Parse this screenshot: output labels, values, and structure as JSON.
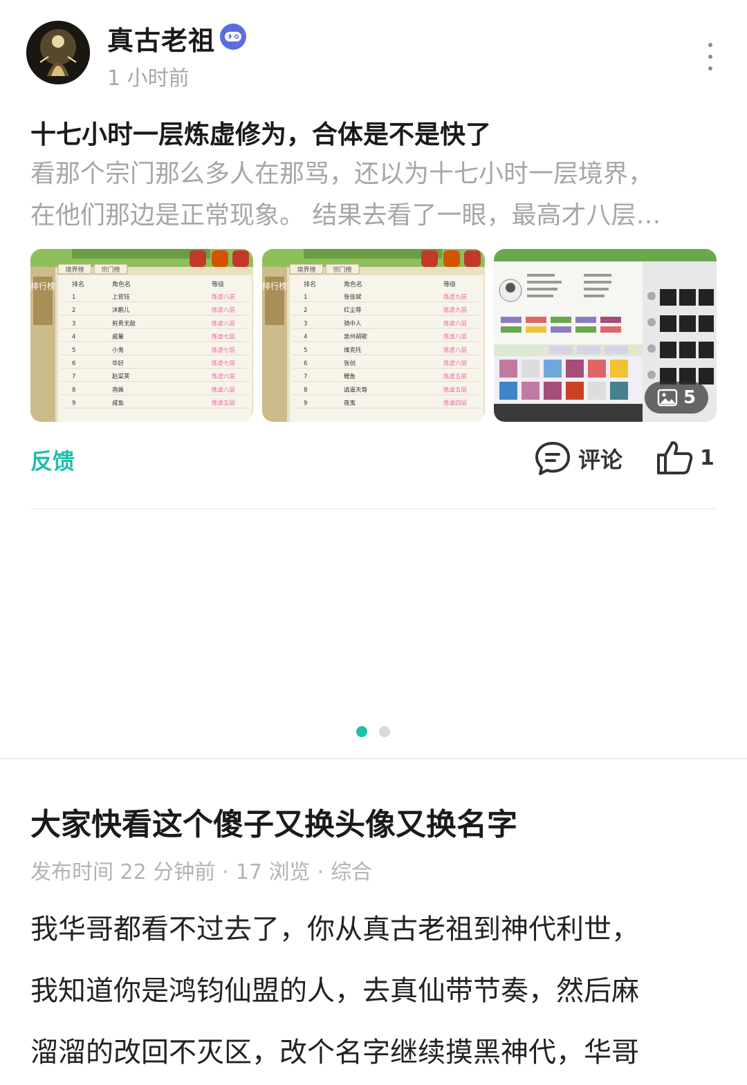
{
  "post": {
    "author": "真古老祖",
    "time": "1 小时前",
    "title": "十七小时一层炼虚修为，合体是不是快了",
    "excerpt_lines": [
      "看那个宗门那么多人在那骂，还以为十七小时一层境界，",
      "在他们那边是正常现象。 结果去看了一眼，最高才八层…"
    ],
    "image_count": "5",
    "feedback_label": "反馈",
    "comment_label": "评论",
    "like_count": "1",
    "thumbnails": [
      {
        "tabs": [
          "境界榜",
          "宗门榜"
        ],
        "headers": [
          "排名",
          "角色名",
          "等级"
        ],
        "rows": [
          [
            "1",
            "上官钰",
            "炼虚八层"
          ],
          [
            "2",
            "沐鹏儿",
            "炼虚八层"
          ],
          [
            "3",
            "剪贵无敌",
            "炼虚八层"
          ],
          [
            "4",
            "戚量",
            "炼虚七层"
          ],
          [
            "5",
            "小鬼",
            "炼虚七层"
          ],
          [
            "6",
            "华好",
            "炼虚七层"
          ],
          [
            "7",
            "赵菜芙",
            "炼虚六层"
          ],
          [
            "8",
            "燕姝",
            "炼虚八层"
          ],
          [
            "9",
            "咸鱼",
            "炼虚五层"
          ]
        ]
      },
      {
        "tabs": [
          "境界榜",
          "宗门榜"
        ],
        "headers": [
          "排名",
          "角色名",
          "等级"
        ],
        "rows": [
          [
            "1",
            "张佳斌",
            "炼虚九层"
          ],
          [
            "2",
            "红尘尊",
            "炼虚九层"
          ],
          [
            "3",
            "骑中人",
            "炼虚六层"
          ],
          [
            "4",
            "泉州胡歌",
            "炼虚八层"
          ],
          [
            "5",
            "维克托",
            "炼虚八层"
          ],
          [
            "6",
            "张创",
            "炼虚六层"
          ],
          [
            "7",
            "鲤鱼",
            "炼虚五层"
          ],
          [
            "8",
            "逍遥天尊",
            "炼虚五层"
          ],
          [
            "9",
            "夜鬼",
            "炼虚四层"
          ]
        ]
      }
    ],
    "ranking_label": "排行榜"
  },
  "article": {
    "title": "大家快看这个傻子又换头像又换名字",
    "meta": [
      "发布时间 22 分钟前",
      "17 浏览",
      "综合"
    ],
    "body_lines": [
      "我华哥都看不过去了，你从真古老祖到神代利世，",
      "我知道你是鸿钧仙盟的人，去真仙带节奏，然后麻",
      "溜溜的改回不灭区，改个名字继续摸黑神代，华哥"
    ]
  },
  "colors": {
    "accent": "#1fbfa8",
    "badge": "#5b6ee1",
    "rank_level_pink": "#e86aa0"
  }
}
